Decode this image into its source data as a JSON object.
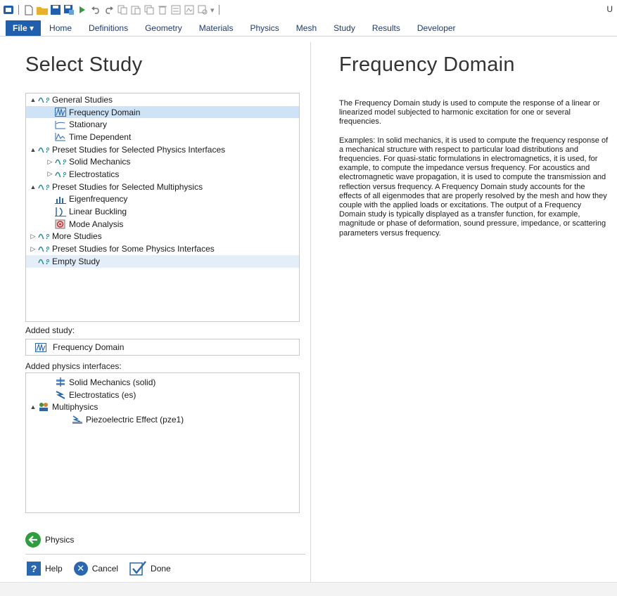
{
  "qat": {
    "trail_text": "U"
  },
  "ribbon": {
    "tabs": [
      {
        "label": "File ▾"
      },
      {
        "label": "Home"
      },
      {
        "label": "Definitions"
      },
      {
        "label": "Geometry"
      },
      {
        "label": "Materials"
      },
      {
        "label": "Physics"
      },
      {
        "label": "Mesh"
      },
      {
        "label": "Study"
      },
      {
        "label": "Results"
      },
      {
        "label": "Developer"
      }
    ]
  },
  "left": {
    "title": "Select Study",
    "tree": [
      {
        "label": "General Studies",
        "depth": 0,
        "caret": "▲",
        "icon": "study-group-icon"
      },
      {
        "label": "Frequency Domain",
        "depth": 1,
        "caret": "",
        "icon": "frequency-domain-icon",
        "selected": true
      },
      {
        "label": "Stationary",
        "depth": 1,
        "caret": "",
        "icon": "stationary-icon"
      },
      {
        "label": "Time Dependent",
        "depth": 1,
        "caret": "",
        "icon": "time-dependent-icon"
      },
      {
        "label": "Preset Studies for Selected Physics Interfaces",
        "depth": 0,
        "caret": "▲",
        "icon": "study-group-icon"
      },
      {
        "label": "Solid Mechanics",
        "depth": 1,
        "caret": "▷",
        "icon": "study-group-icon"
      },
      {
        "label": "Electrostatics",
        "depth": 1,
        "caret": "▷",
        "icon": "study-group-icon"
      },
      {
        "label": "Preset Studies for Selected Multiphysics",
        "depth": 0,
        "caret": "▲",
        "icon": "study-group-icon"
      },
      {
        "label": "Eigenfrequency",
        "depth": 1,
        "caret": "",
        "icon": "eigenfrequency-icon"
      },
      {
        "label": "Linear Buckling",
        "depth": 1,
        "caret": "",
        "icon": "linear-buckling-icon"
      },
      {
        "label": "Mode Analysis",
        "depth": 1,
        "caret": "",
        "icon": "mode-analysis-icon"
      },
      {
        "label": "More Studies",
        "depth": 0,
        "caret": "▷",
        "icon": "study-group-icon"
      },
      {
        "label": "Preset Studies for Some Physics Interfaces",
        "depth": 0,
        "caret": "▷",
        "icon": "study-group-icon"
      },
      {
        "label": "Empty Study",
        "depth": 0,
        "caret": "",
        "icon": "study-group-icon",
        "light": true
      }
    ],
    "added_study_label": "Added study:",
    "added_study_value": "Frequency Domain",
    "added_physics_label": "Added physics interfaces:",
    "physics": [
      {
        "label": "Solid Mechanics (solid)",
        "depth": 1,
        "caret": "",
        "icon": "solid-mechanics-icon"
      },
      {
        "label": "Electrostatics (es)",
        "depth": 1,
        "caret": "",
        "icon": "electrostatics-icon"
      },
      {
        "label": "Multiphysics",
        "depth": 0,
        "caret": "▲",
        "icon": "multiphysics-icon"
      },
      {
        "label": "Piezoelectric Effect (pze1)",
        "depth": 2,
        "caret": "",
        "icon": "piezoelectric-icon"
      }
    ],
    "nav_button": "Physics",
    "help": "Help",
    "cancel": "Cancel",
    "done": "Done"
  },
  "right": {
    "title": "Frequency Domain",
    "paragraphs": [
      "The Frequency Domain study is used to compute the response of a linear or linearized model subjected to harmonic excitation for one or several frequencies.",
      "Examples: In solid mechanics, it is used to compute the frequency response of a mechanical structure with respect to particular load distributions and frequencies. For quasi-static formulations in electromagnetics, it is used, for example, to compute the impedance versus frequency. For acoustics and electromagnetic wave propagation, it is used to compute the transmission and reflection versus frequency. A Frequency Domain study accounts for the effects of all eigenmodes that are properly resolved by the mesh and how they couple with the applied loads or excitations. The output of a Frequency Domain study is typically displayed as a transfer function, for example, magnitude or phase of deformation, sound pressure, impedance, or scattering parameters versus frequency."
    ]
  },
  "colors": {
    "accent": "#1f5fae",
    "selection": "#cfe3f7"
  }
}
